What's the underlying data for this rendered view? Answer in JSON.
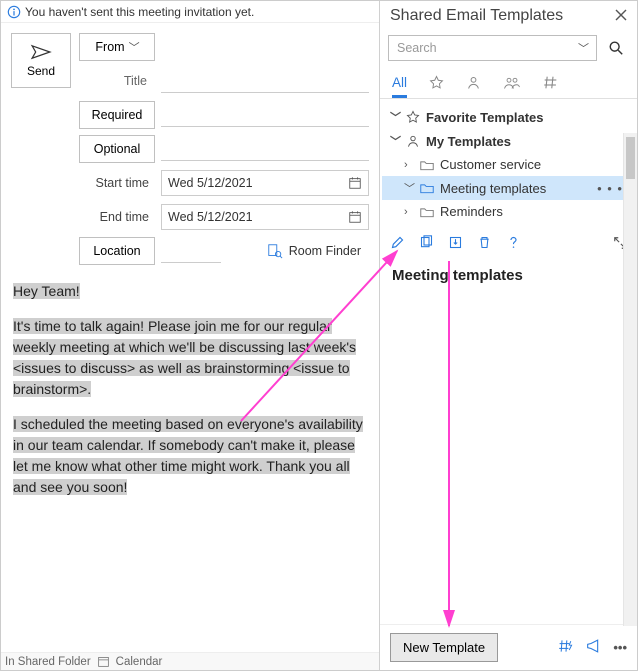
{
  "info_bar": {
    "text": "You haven't sent this meeting invitation yet."
  },
  "compose": {
    "send_label": "Send",
    "from_label": "From",
    "title_label": "Title",
    "required_label": "Required",
    "optional_label": "Optional",
    "start_time_label": "Start time",
    "end_time_label": "End time",
    "location_label": "Location",
    "room_finder_label": "Room Finder",
    "start_time_value": "Wed 5/12/2021",
    "end_time_value": "Wed 5/12/2021",
    "title_value": "",
    "required_value": "",
    "optional_value": "",
    "location_value": ""
  },
  "body_paragraphs": [
    "Hey Team!",
    "It's time to talk again! Please join me for our regular weekly meeting at which we'll be discussing last week's <issues to discuss> as well as brainstorming <issue to brainstorm>.",
    "I scheduled the meeting based on everyone's availability in our team calendar. If somebody can't make it, please let me know what other time might work. Thank you all and see you soon!"
  ],
  "status_bar": {
    "folder_text": "In Shared Folder",
    "calendar_text": "Calendar"
  },
  "side_panel": {
    "title": "Shared Email Templates",
    "search_placeholder": "Search",
    "tabs": {
      "all_label": "All"
    },
    "tree": {
      "favorites_label": "Favorite Templates",
      "my_templates_label": "My Templates",
      "customer_service_label": "Customer service",
      "meeting_templates_label": "Meeting templates",
      "reminders_label": "Reminders"
    },
    "selected_folder_title": "Meeting templates",
    "new_template_label": "New Template"
  },
  "colors": {
    "accent": "#2a7bde",
    "selection": "#cfe6fb",
    "annotation": "#ff3fd0"
  }
}
